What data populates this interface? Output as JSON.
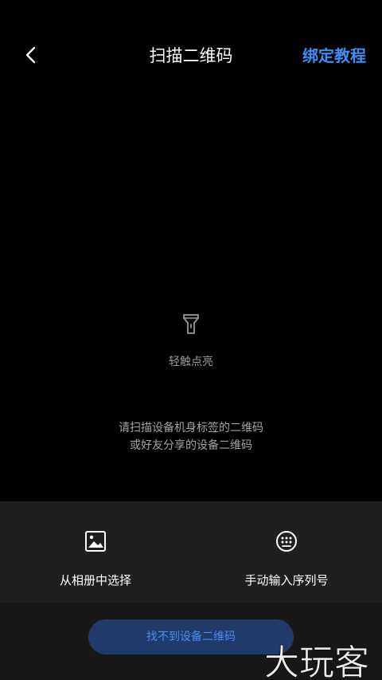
{
  "header": {
    "back_icon": "chevron-left-icon",
    "title": "扫描二维码",
    "tutorial_label": "绑定教程",
    "accent_color": "#3d8ff5"
  },
  "torch": {
    "icon": "flashlight-icon",
    "label": "轻触点亮"
  },
  "hint": {
    "line1": "请扫描设备机身标签的二维码",
    "line2": "或好友分享的设备二维码"
  },
  "options": [
    {
      "icon": "image-icon",
      "label": "从相册中选择"
    },
    {
      "icon": "keypad-icon",
      "label": "手动输入序列号"
    }
  ],
  "footer": {
    "button_label": "找不到设备二维码"
  },
  "watermark": {
    "text": "大玩客"
  }
}
